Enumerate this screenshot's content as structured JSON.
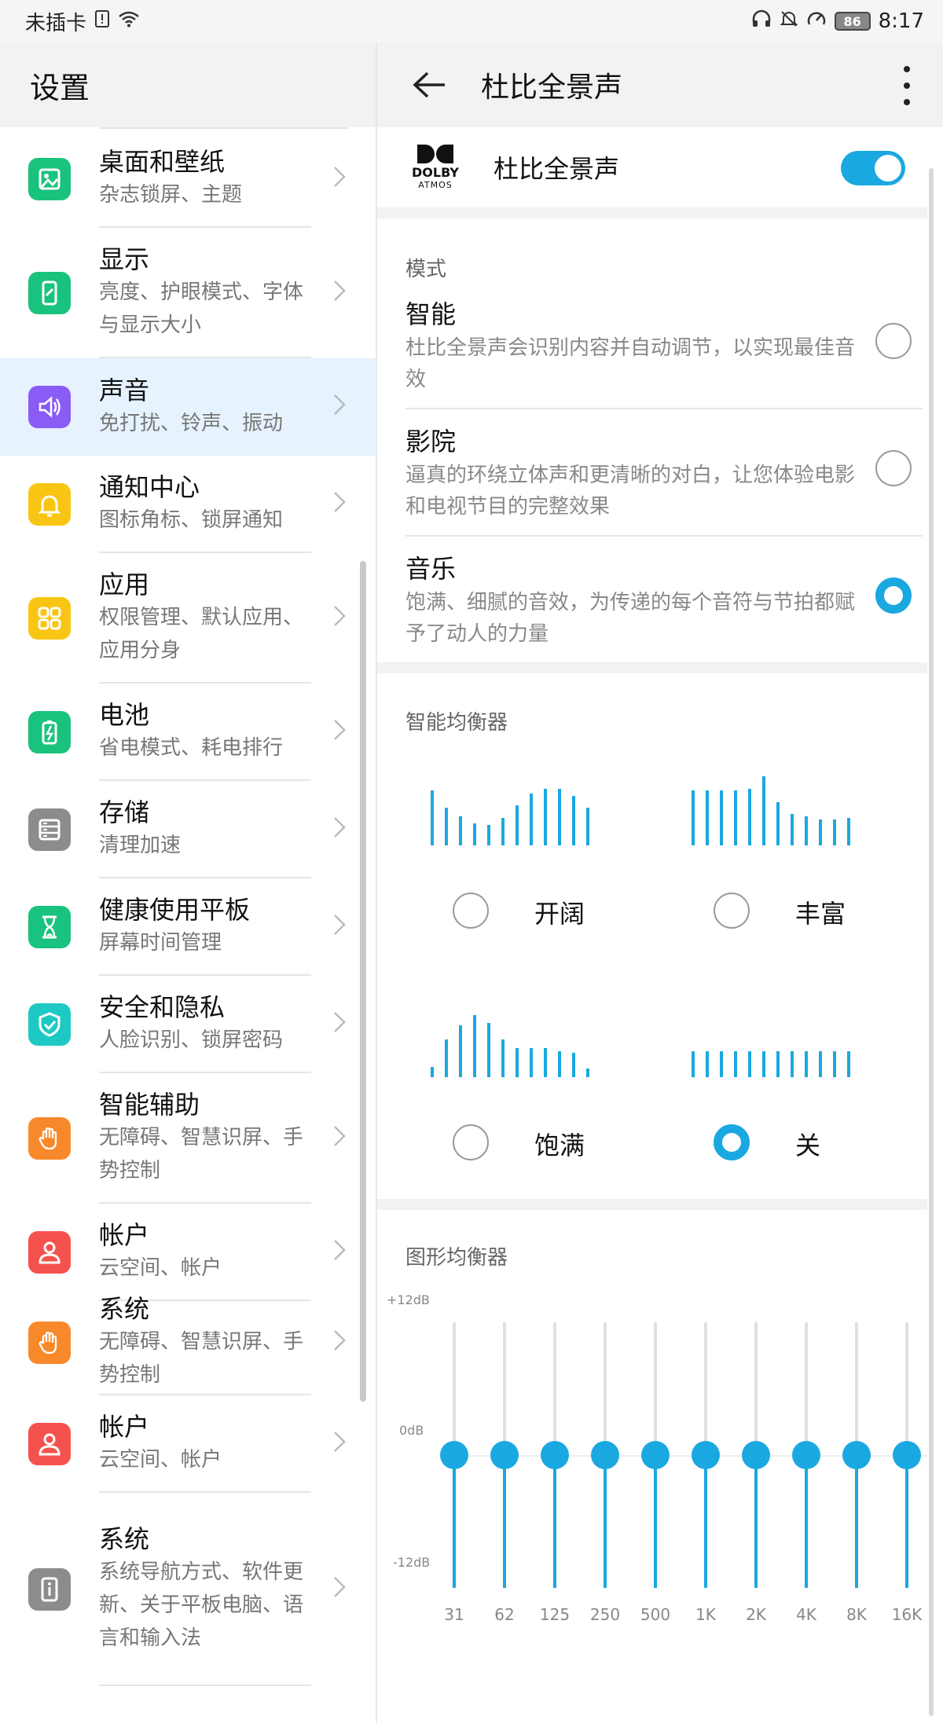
{
  "status_bar": {
    "carrier": "未插卡",
    "time": "8:17",
    "battery": "86"
  },
  "left": {
    "title": "设置",
    "items": [
      {
        "title": "桌面和壁纸",
        "sub": "杂志锁屏、主题",
        "color": "#19c37d",
        "icon": "wallpaper-icon"
      },
      {
        "title": "显示",
        "sub": "亮度、护眼模式、字体与显示大小",
        "color": "#19c37d",
        "icon": "display-icon"
      },
      {
        "title": "声音",
        "sub": "免打扰、铃声、振动",
        "color": "#8a5cf5",
        "icon": "sound-icon",
        "active": true
      },
      {
        "title": "通知中心",
        "sub": "图标角标、锁屏通知",
        "color": "#f9c513",
        "icon": "bell-icon"
      },
      {
        "title": "应用",
        "sub": "权限管理、默认应用、应用分身",
        "color": "#f9c513",
        "icon": "apps-icon"
      },
      {
        "title": "电池",
        "sub": "省电模式、耗电排行",
        "color": "#19c37d",
        "icon": "battery-icon"
      },
      {
        "title": "存储",
        "sub": "清理加速",
        "color": "#8c8c8c",
        "icon": "storage-icon"
      },
      {
        "title": "健康使用平板",
        "sub": "屏幕时间管理",
        "color": "#19c37d",
        "icon": "hourglass-icon"
      },
      {
        "title": "安全和隐私",
        "sub": "人脸识别、锁屏密码",
        "color": "#1fc9c3",
        "icon": "shield-icon"
      },
      {
        "title": "智能辅助",
        "sub": "无障碍、智慧识屏、手势控制",
        "color": "#f7892b",
        "icon": "hand-icon"
      },
      {
        "title": "帐户",
        "sub": "云空间、帐户",
        "color": "#f5524e",
        "icon": "account-icon"
      },
      {
        "title": "系统",
        "sub": "无障碍、智慧识屏、手势控制",
        "color": "#f7892b",
        "icon": "hand-icon"
      },
      {
        "title": "帐户",
        "sub": "云空间、帐户",
        "color": "#f5524e",
        "icon": "account-icon"
      },
      {
        "title": "系统",
        "sub": "系统导航方式、软件更新、关于平板电脑、语言和输入法",
        "color": "#8c8c8c",
        "icon": "info-icon"
      }
    ]
  },
  "right": {
    "title": "杜比全景声",
    "dolby_label": "杜比全景声",
    "dolby_logo_line1": "DOLBY",
    "dolby_logo_line2": "ATMOS",
    "toggle_on": true,
    "mode_label": "模式",
    "modes": [
      {
        "title": "智能",
        "desc": "杜比全景声会识别内容并自动调节，以实现最佳音效",
        "selected": false
      },
      {
        "title": "影院",
        "desc": "逼真的环绕立体声和更清晰的对白，让您体验电影和电视节目的完整效果",
        "selected": false
      },
      {
        "title": "音乐",
        "desc": "饱满、细腻的音效，为传递的每个音符与节拍都赋予了动人的力量",
        "selected": true
      }
    ],
    "smart_eq_label": "智能均衡器",
    "presets": [
      {
        "label": "开阔",
        "selected": false,
        "levels": [
          0.8,
          0.55,
          0.42,
          0.32,
          0.3,
          0.4,
          0.58,
          0.75,
          0.82,
          0.82,
          0.72,
          0.55
        ]
      },
      {
        "label": "丰富",
        "selected": false,
        "levels": [
          0.8,
          0.8,
          0.8,
          0.8,
          0.82,
          1.0,
          0.62,
          0.45,
          0.42,
          0.38,
          0.38,
          0.4
        ]
      },
      {
        "label": "饱满",
        "selected": false,
        "levels": [
          0.15,
          0.55,
          0.75,
          0.9,
          0.78,
          0.55,
          0.42,
          0.42,
          0.42,
          0.38,
          0.35,
          0.12
        ]
      },
      {
        "label": "关",
        "selected": true,
        "levels": [
          0.38,
          0.38,
          0.38,
          0.38,
          0.38,
          0.38,
          0.38,
          0.38,
          0.38,
          0.38,
          0.38,
          0.38
        ]
      }
    ],
    "graphic_eq_label": "图形均衡器",
    "db_top": "+12dB",
    "db_mid": "0dB",
    "db_bottom": "-12dB",
    "bands": [
      "31",
      "62",
      "125",
      "250",
      "500",
      "1K",
      "2K",
      "4K",
      "8K",
      "16K"
    ],
    "band_gain_db": [
      0,
      0,
      0,
      0,
      0,
      0,
      0,
      0,
      0,
      0
    ],
    "accent": "#1aa8e0"
  }
}
